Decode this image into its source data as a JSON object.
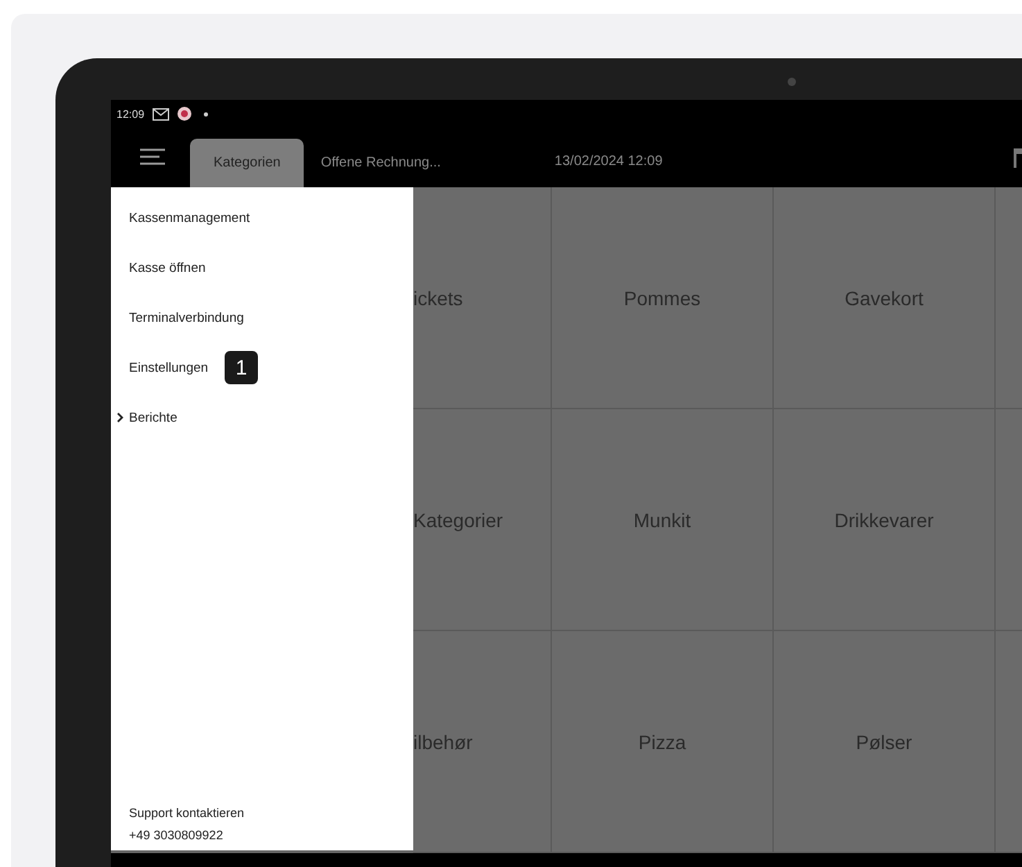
{
  "status_bar": {
    "time": "12:09"
  },
  "app_bar": {
    "tabs": [
      {
        "label": "Kategorien",
        "selected": true
      },
      {
        "label": "Offene Rechnung...",
        "selected": false
      }
    ],
    "datetime": "13/02/2024 12:09"
  },
  "drawer": {
    "items": [
      {
        "label": "Kassenmanagement",
        "kind": "link"
      },
      {
        "label": "Kasse öffnen",
        "kind": "link"
      },
      {
        "label": "Terminalverbindung",
        "kind": "link"
      },
      {
        "label": "Einstellungen",
        "kind": "link",
        "badge": "1"
      },
      {
        "label": "Berichte",
        "kind": "group",
        "expanded": false
      }
    ],
    "support": {
      "label": "Support kontaktieren",
      "phone": "+49 3030809922"
    }
  },
  "grid": {
    "rows": [
      [
        "ickets",
        "Pommes",
        "Gavekort"
      ],
      [
        "Kategorier",
        "Munkit",
        "Drikkevarer"
      ],
      [
        "ilbehør",
        "Pizza",
        "Pølser"
      ]
    ]
  }
}
